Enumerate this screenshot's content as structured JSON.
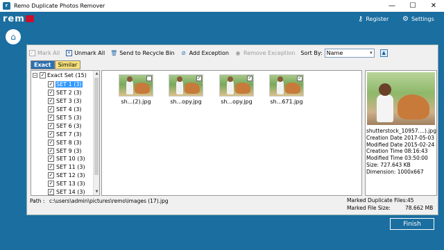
{
  "window": {
    "title": "Remo Duplicate Photos Remover",
    "minimize": "—",
    "maximize": "☐",
    "close": "✕"
  },
  "header": {
    "logo_text": "rem",
    "register_label": "Register",
    "settings_label": "Settings",
    "register_icon": "key-icon",
    "settings_icon": "gear-icon"
  },
  "toolbar": {
    "mark_all": "Mark All",
    "unmark_all": "Unmark All",
    "send_to_recycle": "Send to Recycle Bin",
    "add_exception": "Add Exception",
    "remove_exception": "Remove Exception",
    "sort_by_label": "Sort By:",
    "sort_by_value": "Name"
  },
  "tabs": {
    "exact": "Exact",
    "similar": "Similar"
  },
  "tree": {
    "root_label": "Exact Set (15)",
    "items": [
      {
        "label": "SET 1 (3)",
        "selected": true
      },
      {
        "label": "SET 2 (3)"
      },
      {
        "label": "SET 3 (3)"
      },
      {
        "label": "SET 4 (3)"
      },
      {
        "label": "SET 5 (3)"
      },
      {
        "label": "SET 6 (3)"
      },
      {
        "label": "SET 7 (3)"
      },
      {
        "label": "SET 8 (3)"
      },
      {
        "label": "SET 9 (3)"
      },
      {
        "label": "SET 10 (3)"
      },
      {
        "label": "SET 11 (3)"
      },
      {
        "label": "SET 12 (3)"
      },
      {
        "label": "SET 13 (3)"
      },
      {
        "label": "SET 14 (3)"
      }
    ]
  },
  "thumbnails": [
    {
      "name": "sh...(2).jpg",
      "checked": false
    },
    {
      "name": "sh...opy.jpg",
      "checked": true
    },
    {
      "name": "sh...opy.jpg",
      "checked": true
    },
    {
      "name": "sh...671.jpg",
      "checked": true
    }
  ],
  "preview": {
    "filename": "shutterstock_10957....).jpg",
    "creation_date": "Creation Date 2017-05-03",
    "modified_date": "Modified Date 2015-02-24",
    "creation_time": "Creation Time 08:16:43",
    "modified_time": "Modified Time 03:50:00",
    "size": "Size: 727.643 KB",
    "dimension": "Dimension: 1000x667"
  },
  "status": {
    "path_label": "Path :",
    "path_value": "c:\\users\\admin\\pictures\\remo\\images (17).jpg",
    "marked_files_label": "Marked Duplicate Files:",
    "marked_files_value": "45",
    "marked_size_label": "Marked File Size:",
    "marked_size_value": "78.662  MB"
  },
  "footer": {
    "finish_label": "Finish"
  }
}
